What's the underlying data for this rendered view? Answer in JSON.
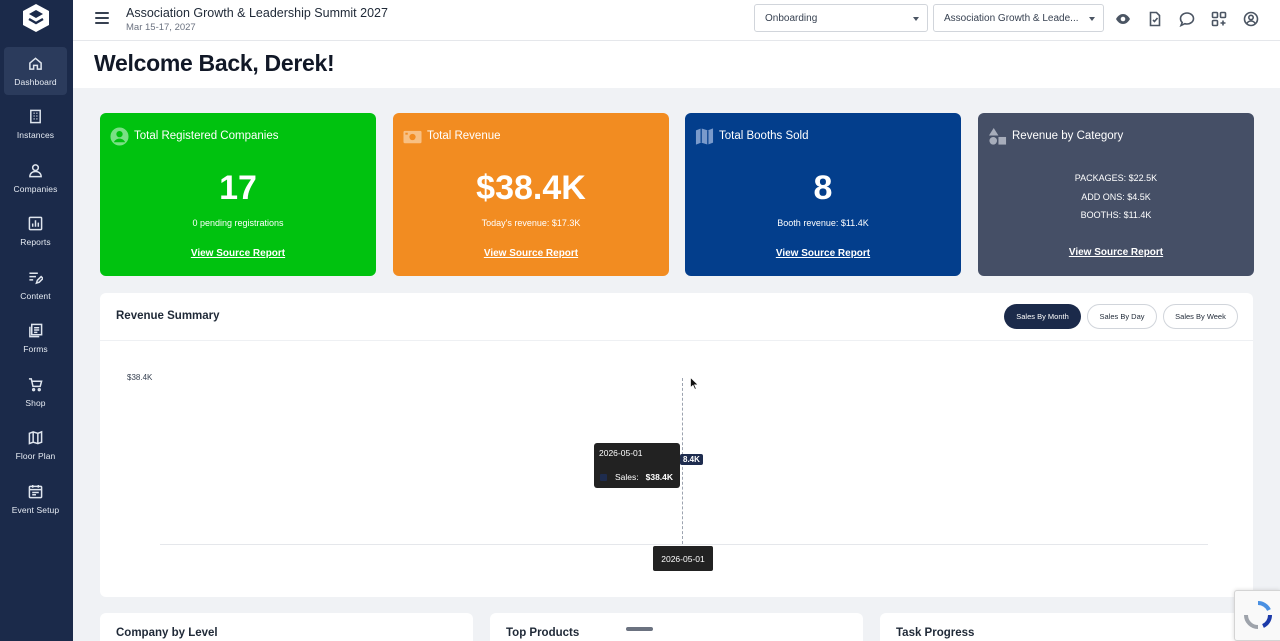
{
  "sidebar": {
    "items": [
      {
        "label": "Dashboard",
        "icon": "home-icon"
      },
      {
        "label": "Instances",
        "icon": "building-icon"
      },
      {
        "label": "Companies",
        "icon": "users-icon"
      },
      {
        "label": "Reports",
        "icon": "bar-chart-icon"
      },
      {
        "label": "Content",
        "icon": "edit-list-icon"
      },
      {
        "label": "Forms",
        "icon": "forms-icon"
      },
      {
        "label": "Shop",
        "icon": "cart-icon"
      },
      {
        "label": "Floor Plan",
        "icon": "map-icon"
      },
      {
        "label": "Event Setup",
        "icon": "calendar-icon"
      }
    ],
    "active": "Dashboard"
  },
  "header": {
    "event_title": "Association Growth & Leadership Summit 2027",
    "event_date": "Mar 15-17, 2027",
    "stage_select": "Onboarding",
    "event_select": "Association Growth & Leade..."
  },
  "welcome": "Welcome Back, Derek!",
  "cards": {
    "companies": {
      "title": "Total Registered Companies",
      "value": "17",
      "sub": "0 pending registrations",
      "link": "View Source Report",
      "color": "#00c20f"
    },
    "revenue": {
      "title": "Total Revenue",
      "value": "$38.4K",
      "sub": "Today's revenue: $17.3K",
      "link": "View Source Report",
      "color": "#f28c21"
    },
    "booths": {
      "title": "Total Booths Sold",
      "value": "8",
      "sub": "Booth revenue: $11.4K",
      "link": "View Source Report",
      "color": "#033e8c"
    },
    "category": {
      "title": "Revenue by Category",
      "lines": [
        "PACKAGES: $22.5K",
        "ADD ONS: $4.5K",
        "BOOTHS: $11.4K"
      ],
      "link": "View Source Report",
      "color": "#454f66"
    }
  },
  "revenue_summary": {
    "title": "Revenue Summary",
    "buttons": [
      "Sales By Month",
      "Sales By Day",
      "Sales By Week"
    ],
    "active_button": "Sales By Month",
    "y_tick": "$38.4K",
    "point_label": "$38.4K",
    "point_label_visible": "8.4K",
    "tooltip": {
      "date": "2026-05-01",
      "series": "Sales:",
      "value": "$38.4K"
    },
    "x_tick": "2026-05-01"
  },
  "panels": [
    "Company by Level",
    "Top Products",
    "Task Progress"
  ]
}
